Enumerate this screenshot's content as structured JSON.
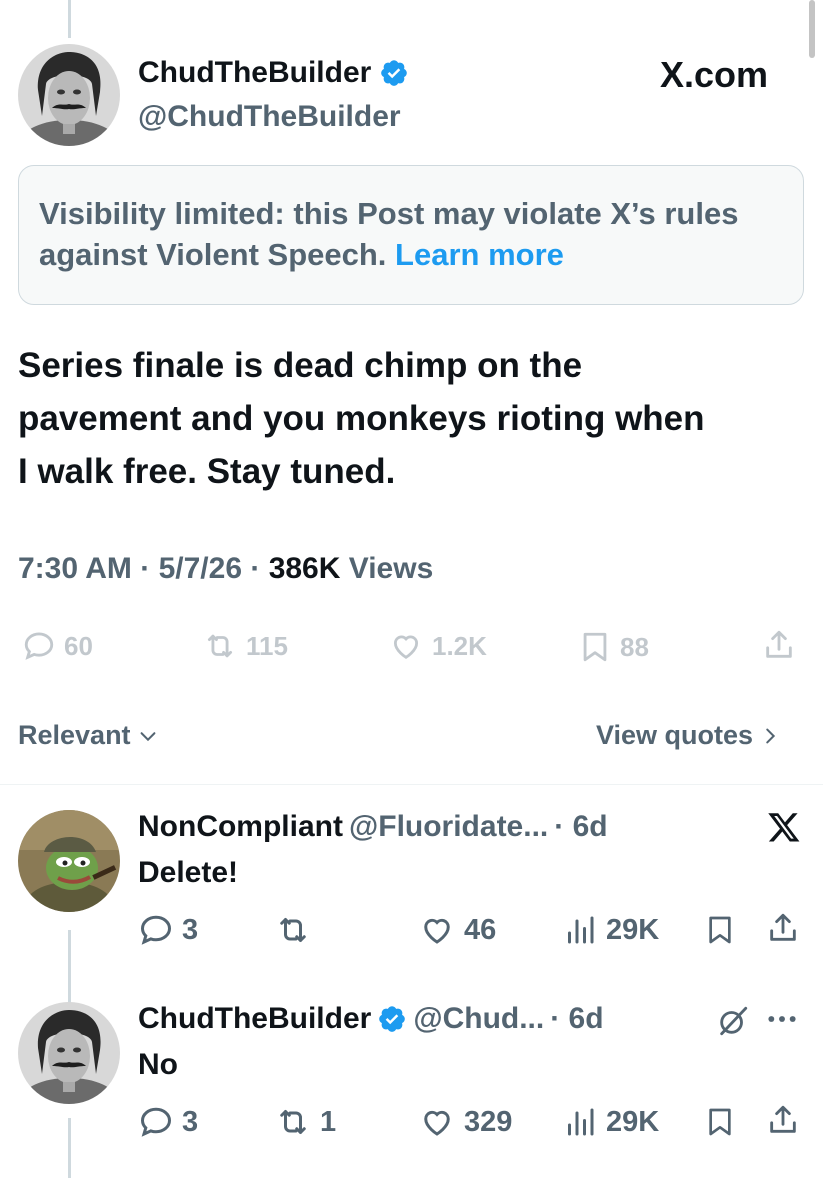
{
  "post": {
    "display_name": "ChudTheBuilder",
    "handle": "@ChudTheBuilder",
    "site": "X.com",
    "notice_text": "Visibility limited: this Post may violate X’s rules against Violent Speech.",
    "notice_link": "Learn more",
    "body_line1": "Series finale is dead chimp on the",
    "body_line2": "pavement and you monkeys rioting when",
    "body_line3": "I walk free. Stay tuned.",
    "time": "7:30 AM",
    "date": "5/7/26",
    "views_count": "386K",
    "views_label": "Views",
    "replies": "60",
    "reposts": "115",
    "likes": "1.2K",
    "bookmarks": "88"
  },
  "sort": {
    "label": "Relevant",
    "view_quotes": "View quotes"
  },
  "replies": [
    {
      "display_name": "NonCompliant",
      "handle": "@Fluoridate...",
      "age": "· 6d",
      "text": "Delete!",
      "replies": "3",
      "reposts": "",
      "likes": "46",
      "views": "29K"
    },
    {
      "display_name": "ChudTheBuilder",
      "handle": "@Chud...",
      "age": "· 6d",
      "text": "No",
      "replies": "3",
      "reposts": "1",
      "likes": "329",
      "views": "29K"
    }
  ],
  "colors": {
    "accent": "#1d9bf0",
    "text": "#0f1419",
    "muted": "#536471",
    "border": "#cfd9de"
  }
}
